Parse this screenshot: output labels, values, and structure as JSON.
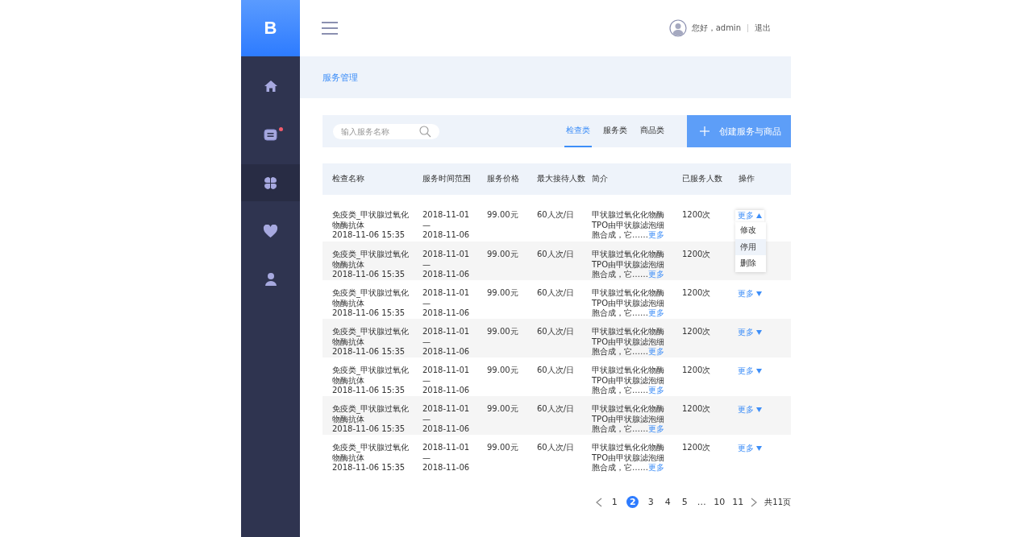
{
  "sidebar": {
    "logo": "B",
    "items": [
      {
        "kind": "home",
        "selected": false
      },
      {
        "kind": "message",
        "selected": false,
        "badge": true
      },
      {
        "kind": "grid",
        "selected": true
      },
      {
        "kind": "heart",
        "selected": false
      },
      {
        "kind": "user",
        "selected": false
      }
    ]
  },
  "header": {
    "greeting": "您好，admin",
    "logout": "退出"
  },
  "breadcrumb": "服务管理",
  "toolbar": {
    "search": {
      "placeholder": "输入服务名称"
    },
    "tabs": [
      {
        "label": "检查类",
        "selected": true
      },
      {
        "label": "服务类",
        "selected": false
      },
      {
        "label": "商品类",
        "selected": false
      }
    ],
    "create_button": "创建服务与商品"
  },
  "table": {
    "columns": [
      "检查名称",
      "服务时间范围",
      "服务价格",
      "最大接待人数",
      "简介",
      "已服务人数",
      "操作"
    ],
    "rows": [
      {
        "name": "免疫类_甲状腺过氧化物酶抗体",
        "created": "2018-11-06  15:35",
        "time_start": "2018-11-01",
        "time_sep": "—",
        "time_end": "2018-11-06",
        "price": "99.00元",
        "capacity": "60人次/日",
        "intro": "甲状腺过氧化化物酶TPO由甲状腺滤泡细胞合成，它……",
        "intro_link": "更多",
        "served": "1200次",
        "action": "更多",
        "expanded": true,
        "menu": [
          {
            "label": "修改",
            "selected": false
          },
          {
            "label": "停用",
            "selected": true
          },
          {
            "label": "删除",
            "selected": false
          }
        ]
      },
      {
        "name": "免疫类_甲状腺过氧化物酶抗体",
        "created": "2018-11-06  15:35",
        "time_start": "2018-11-01",
        "time_sep": "—",
        "time_end": "2018-11-06",
        "price": "99.00元",
        "capacity": "60人次/日",
        "intro": "甲状腺过氧化化物酶TPO由甲状腺滤泡细胞合成，它……",
        "intro_link": "更多",
        "served": "1200次"
      },
      {
        "name": "免疫类_甲状腺过氧化物酶抗体",
        "created": "2018-11-06  15:35",
        "time_start": "2018-11-01",
        "time_sep": "—",
        "time_end": "2018-11-06",
        "price": "99.00元",
        "capacity": "60人次/日",
        "intro": "甲状腺过氧化化物酶TPO由甲状腺滤泡细胞合成，它……",
        "intro_link": "更多",
        "served": "1200次",
        "action": "更多",
        "expanded": false
      },
      {
        "name": "免疫类_甲状腺过氧化物酶抗体",
        "created": "2018-11-06  15:35",
        "time_start": "2018-11-01",
        "time_sep": "—",
        "time_end": "2018-11-06",
        "price": "99.00元",
        "capacity": "60人次/日",
        "intro": "甲状腺过氧化化物酶TPO由甲状腺滤泡细胞合成，它……",
        "intro_link": "更多",
        "served": "1200次",
        "action": "更多",
        "expanded": false
      },
      {
        "name": "免疫类_甲状腺过氧化物酶抗体",
        "created": "2018-11-06  15:35",
        "time_start": "2018-11-01",
        "time_sep": "—",
        "time_end": "2018-11-06",
        "price": "99.00元",
        "capacity": "60人次/日",
        "intro": "甲状腺过氧化化物酶TPO由甲状腺滤泡细胞合成，它……",
        "intro_link": "更多",
        "served": "1200次",
        "action": "更多",
        "expanded": false
      },
      {
        "name": "免疫类_甲状腺过氧化物酶抗体",
        "created": "2018-11-06  15:35",
        "time_start": "2018-11-01",
        "time_sep": "—",
        "time_end": "2018-11-06",
        "price": "99.00元",
        "capacity": "60人次/日",
        "intro": "甲状腺过氧化化物酶TPO由甲状腺滤泡细胞合成，它……",
        "intro_link": "更多",
        "served": "1200次",
        "action": "更多",
        "expanded": false
      },
      {
        "name": "免疫类_甲状腺过氧化物酶抗体",
        "created": "2018-11-06  15:35",
        "time_start": "2018-11-01",
        "time_sep": "—",
        "time_end": "2018-11-06",
        "price": "99.00元",
        "capacity": "60人次/日",
        "intro": "甲状腺过氧化化物酶TPO由甲状腺滤泡细胞合成，它……",
        "intro_link": "更多",
        "served": "1200次",
        "action": "更多",
        "expanded": false
      }
    ]
  },
  "pagination": {
    "pages": [
      {
        "label": "1",
        "selected": false
      },
      {
        "label": "2",
        "selected": true
      },
      {
        "label": "3",
        "selected": false
      },
      {
        "label": "4",
        "selected": false
      },
      {
        "label": "5",
        "selected": false
      },
      {
        "label": "…",
        "selected": false
      },
      {
        "label": "10",
        "selected": false
      },
      {
        "label": "11",
        "selected": false
      }
    ],
    "total": "共11页"
  }
}
